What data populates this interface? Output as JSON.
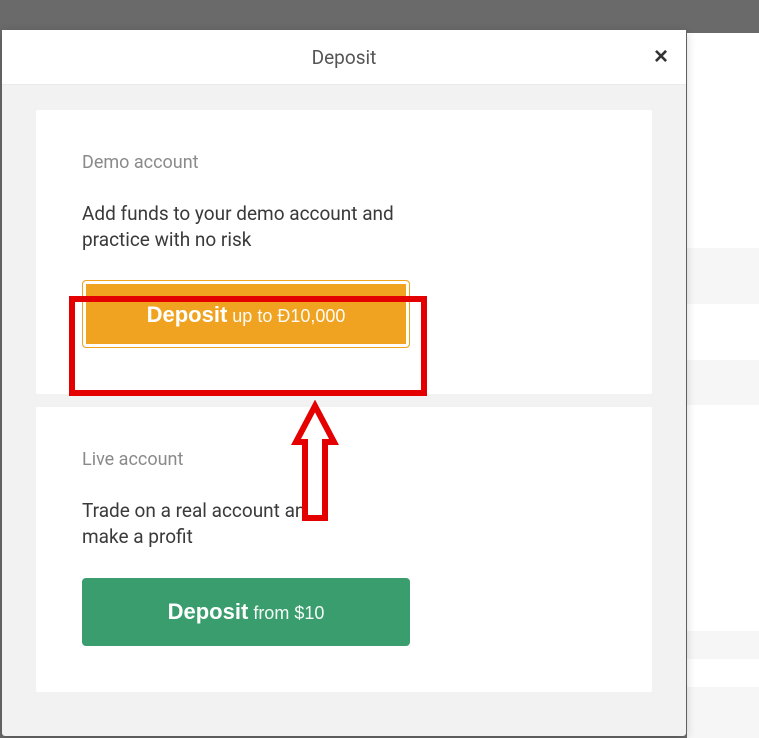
{
  "modal": {
    "title": "Deposit",
    "close_glyph": "×"
  },
  "demo": {
    "label": "Demo account",
    "description": "Add funds to your demo account and practice with no risk",
    "button_bold": "Deposit",
    "button_light": " up to Ð10,000"
  },
  "live": {
    "label": "Live account",
    "description": "Trade on a real account and make a profit",
    "button_bold": "Deposit",
    "button_light": " from $10"
  },
  "annotation": {
    "highlight_color": "#e40000"
  }
}
